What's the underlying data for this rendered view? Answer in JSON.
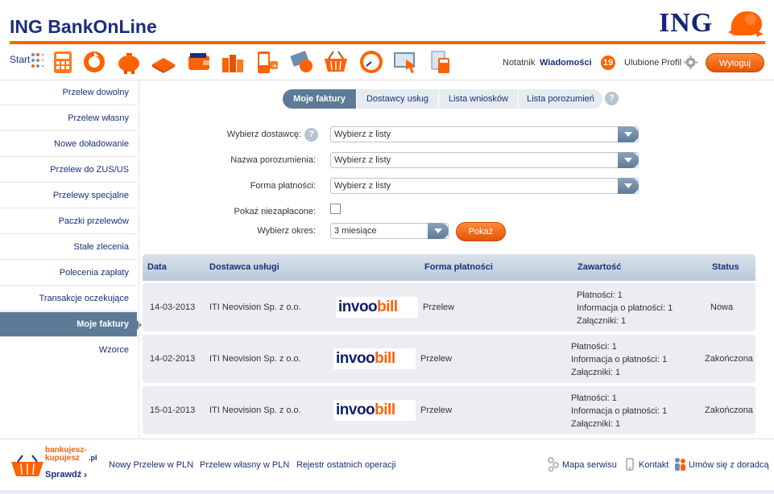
{
  "header": {
    "title": "ING BankOnLine",
    "logo": "ING",
    "colors": {
      "brand_blue": "#1a2f7a",
      "accent_orange": "#ff6200",
      "panel_blue": "#5d7a97"
    }
  },
  "toolbar": {
    "start_label": "Start",
    "icons": [
      "calculator-icon",
      "globe-refresh-icon",
      "piggy-bank-icon",
      "book-icon",
      "wallet-icon",
      "coins-icon",
      "mobile-recharge-icon",
      "insurance-card-icon",
      "shopping-basket-icon",
      "gauge-icon",
      "cursor-screen-icon",
      "documents-calculator-icon"
    ],
    "notepad": "Notatnik",
    "messages": "Wiadomości",
    "messages_count": "19",
    "favorites": "Ulubione",
    "profile": "Profil",
    "logout": "Wyloguj"
  },
  "sidebar": {
    "items": [
      {
        "label": "Przelew dowolny"
      },
      {
        "label": "Przelew własny"
      },
      {
        "label": "Nowe doładowanie"
      },
      {
        "label": "Przelew do ZUS/US"
      },
      {
        "label": "Przelewy specjalne"
      },
      {
        "label": "Paczki przelewów"
      },
      {
        "label": "Stałe zlecenia"
      },
      {
        "label": "Polecenia zapłaty"
      },
      {
        "label": "Transakcje oczekujące"
      },
      {
        "label": "Moje faktury"
      },
      {
        "label": "Wzorce"
      }
    ],
    "active_index": 9
  },
  "tabs": [
    {
      "label": "Moje faktury"
    },
    {
      "label": "Dostawcy usług"
    },
    {
      "label": "Lista wniosków"
    },
    {
      "label": "Lista porozumień"
    }
  ],
  "help_symbol": "?",
  "form": {
    "provider_label": "Wybierz dostawcę:",
    "provider_value": "Wybierz z listy",
    "agreement_label": "Nazwa porozumienia:",
    "agreement_value": "Wybierz z listy",
    "payment_label": "Forma płatności:",
    "payment_value": "Wybierz z listy",
    "unpaid_label": "Pokaż niezapłacone:",
    "period_label": "Wybierz okres:",
    "period_value": "3 miesiące",
    "show_button": "Pokaż"
  },
  "table": {
    "headers": [
      "Data",
      "Dostawca usługi",
      "Forma płatności",
      "Zawartość",
      "Status"
    ],
    "logo_part1": "invoo",
    "logo_part2": "bill",
    "rows": [
      {
        "date": "14-03-2013",
        "provider": "ITI Neovision Sp. z o.o.",
        "payment": "Przelew",
        "payments": "Płatności: 1",
        "info": "Informacja o płatności: 1",
        "attachments": "Załączniki: 1",
        "status": "Nowa"
      },
      {
        "date": "14-02-2013",
        "provider": "ITI Neovision Sp. z o.o.",
        "payment": "Przelew",
        "payments": "Płatności: 1",
        "info": "Informacja o płatności: 1",
        "attachments": "Załączniki: 1",
        "status": "Zakończona"
      },
      {
        "date": "15-01-2013",
        "provider": "ITI Neovision Sp. z o.o.",
        "payment": "Przelew",
        "payments": "Płatności: 1",
        "info": "Informacja o płatności: 1",
        "attachments": "Załączniki: 1",
        "status": "Zakończona"
      }
    ]
  },
  "footer": {
    "promo_line1": "bankujesz-",
    "promo_line2": "kupujesz",
    "promo_pl": ".pl",
    "promo_check": "Sprawdź",
    "links": [
      "Nowy Przelew w PLN",
      "Przelew własny w PLN",
      "Rejestr ostatnich operacji"
    ],
    "sitemap": "Mapa serwisu",
    "contact": "Kontakt",
    "advisor": "Umów się z doradcą"
  }
}
